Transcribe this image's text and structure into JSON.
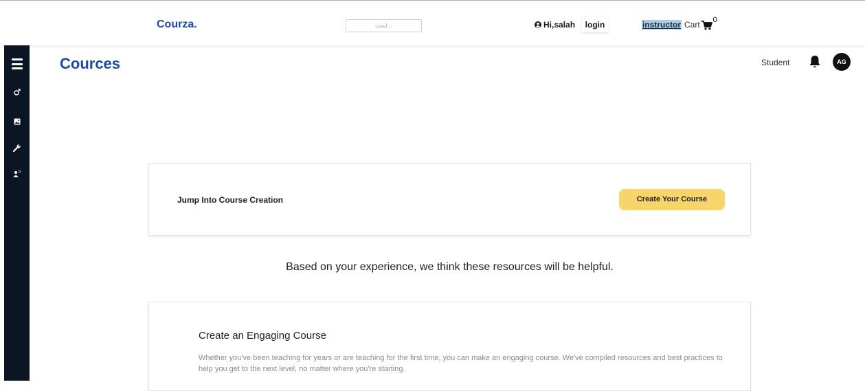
{
  "header": {
    "brand": "Courza.",
    "search_placeholder": "ابحث...",
    "greeting": "Hi,salah",
    "login_label": "login",
    "instructor_label": "instructor",
    "cart_label": "Cart",
    "cart_count": "0"
  },
  "sidebar": {
    "items": [
      "menu-icon",
      "gender-icon",
      "image-icon",
      "wrench-icon",
      "user-gear-icon"
    ]
  },
  "page": {
    "title": "Cources",
    "role_label": "Student",
    "avatar_initials": "AG"
  },
  "creation_card": {
    "text": "Jump Into Course Creation",
    "button_label": "Create Your Course",
    "button_color": "#f8d56b"
  },
  "resources": {
    "heading": "Based on your experience, we think these resources will be helpful.",
    "card_title": "Create an Engaging Course",
    "card_description": "Whether you've been teaching for years or are teaching for the first time, you can make an engaging course. We've compiled resources and best practices to help you get to the next level, no matter where you're starting."
  },
  "colors": {
    "brand": "#1b4ba6",
    "sidebar_bg": "#0c1524"
  }
}
